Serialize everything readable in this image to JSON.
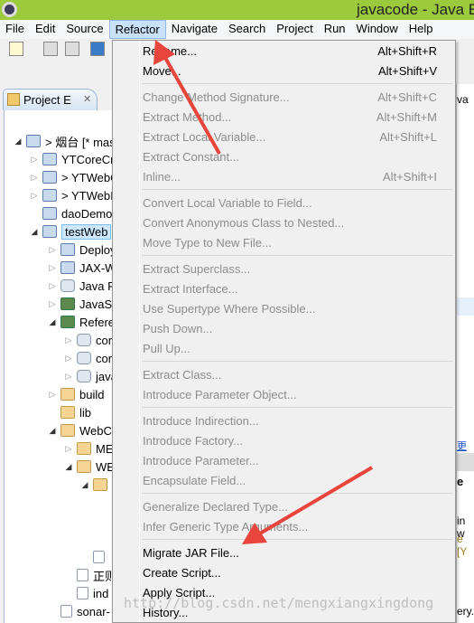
{
  "window": {
    "title": "javacode - Java EE"
  },
  "menubar": [
    "File",
    "Edit",
    "Source",
    "Refactor",
    "Navigate",
    "Search",
    "Project",
    "Run",
    "Window",
    "Help"
  ],
  "active_menu": "Refactor",
  "panel": {
    "tab_label": "Project E",
    "close": "✕"
  },
  "tree": [
    {
      "label": "> 烟台 [* mas",
      "depth": 0,
      "tw": "open",
      "icon": "proj"
    },
    {
      "label": "YTCoreCr",
      "depth": 1,
      "tw": "closed",
      "icon": "proj"
    },
    {
      "label": "> YTWebC",
      "depth": 1,
      "tw": "closed",
      "icon": "proj"
    },
    {
      "label": "> YTWebI",
      "depth": 1,
      "tw": "closed",
      "icon": "proj"
    },
    {
      "label": "daoDemo",
      "depth": 1,
      "tw": "",
      "icon": "proj"
    },
    {
      "label": "testWeb",
      "depth": 1,
      "tw": "open",
      "icon": "proj",
      "selected": true
    },
    {
      "label": "Deploy",
      "depth": 2,
      "tw": "closed",
      "icon": "proj"
    },
    {
      "label": "JAX-W",
      "depth": 2,
      "tw": "closed",
      "icon": "proj"
    },
    {
      "label": "Java R",
      "depth": 2,
      "tw": "closed",
      "icon": "jar"
    },
    {
      "label": "JavaSc",
      "depth": 2,
      "tw": "closed",
      "icon": "lib"
    },
    {
      "label": "Refere",
      "depth": 2,
      "tw": "open",
      "icon": "lib"
    },
    {
      "label": "cor",
      "depth": 3,
      "tw": "closed",
      "icon": "jar"
    },
    {
      "label": "cor",
      "depth": 3,
      "tw": "closed",
      "icon": "jar"
    },
    {
      "label": "java",
      "depth": 3,
      "tw": "closed",
      "icon": "jar"
    },
    {
      "label": "build",
      "depth": 2,
      "tw": "closed",
      "icon": "folder"
    },
    {
      "label": "lib",
      "depth": 2,
      "tw": "",
      "icon": "folder"
    },
    {
      "label": "WebCo",
      "depth": 2,
      "tw": "open",
      "icon": "folder"
    },
    {
      "label": "ME",
      "depth": 3,
      "tw": "closed",
      "icon": "folder"
    },
    {
      "label": "WE",
      "depth": 3,
      "tw": "open",
      "icon": "folder"
    },
    {
      "label": "",
      "depth": 4,
      "tw": "open",
      "icon": "folder"
    },
    {
      "label": "",
      "depth": 5,
      "tw": "",
      "icon": ""
    },
    {
      "label": "",
      "depth": 5,
      "tw": "",
      "icon": ""
    },
    {
      "label": "",
      "depth": 5,
      "tw": "",
      "icon": ""
    },
    {
      "label": "",
      "depth": 4,
      "tw": "",
      "icon": "file"
    },
    {
      "label": "正则",
      "depth": 3,
      "tw": "",
      "icon": "file"
    },
    {
      "label": "ind",
      "depth": 3,
      "tw": "",
      "icon": "file"
    },
    {
      "label": "sonar-",
      "depth": 2,
      "tw": "",
      "icon": "file"
    }
  ],
  "refactor_menu": [
    {
      "label": "Rename...",
      "shortcut": "Alt+Shift+R",
      "enabled": true
    },
    {
      "label": "Move...",
      "shortcut": "Alt+Shift+V",
      "enabled": true
    },
    {
      "sep": true
    },
    {
      "label": "Change Method Signature...",
      "shortcut": "Alt+Shift+C",
      "enabled": false
    },
    {
      "label": "Extract Method...",
      "shortcut": "Alt+Shift+M",
      "enabled": false
    },
    {
      "label": "Extract Local Variable...",
      "shortcut": "Alt+Shift+L",
      "enabled": false
    },
    {
      "label": "Extract Constant...",
      "shortcut": "",
      "enabled": false
    },
    {
      "label": "Inline...",
      "shortcut": "Alt+Shift+I",
      "enabled": false
    },
    {
      "sep": true
    },
    {
      "label": "Convert Local Variable to Field...",
      "shortcut": "",
      "enabled": false
    },
    {
      "label": "Convert Anonymous Class to Nested...",
      "shortcut": "",
      "enabled": false
    },
    {
      "label": "Move Type to New File...",
      "shortcut": "",
      "enabled": false
    },
    {
      "sep": true
    },
    {
      "label": "Extract Superclass...",
      "shortcut": "",
      "enabled": false
    },
    {
      "label": "Extract Interface...",
      "shortcut": "",
      "enabled": false
    },
    {
      "label": "Use Supertype Where Possible...",
      "shortcut": "",
      "enabled": false
    },
    {
      "label": "Push Down...",
      "shortcut": "",
      "enabled": false
    },
    {
      "label": "Pull Up...",
      "shortcut": "",
      "enabled": false
    },
    {
      "sep": true
    },
    {
      "label": "Extract Class...",
      "shortcut": "",
      "enabled": false
    },
    {
      "label": "Introduce Parameter Object...",
      "shortcut": "",
      "enabled": false
    },
    {
      "sep": true
    },
    {
      "label": "Introduce Indirection...",
      "shortcut": "",
      "enabled": false
    },
    {
      "label": "Introduce Factory...",
      "shortcut": "",
      "enabled": false
    },
    {
      "label": "Introduce Parameter...",
      "shortcut": "",
      "enabled": false
    },
    {
      "label": "Encapsulate Field...",
      "shortcut": "",
      "enabled": false
    },
    {
      "sep": true
    },
    {
      "label": "Generalize Declared Type...",
      "shortcut": "",
      "enabled": false
    },
    {
      "label": "Infer Generic Type Arguments...",
      "shortcut": "",
      "enabled": false
    },
    {
      "sep": true
    },
    {
      "label": "Migrate JAR File...",
      "shortcut": "",
      "enabled": true
    },
    {
      "label": "Create Script...",
      "shortcut": "",
      "enabled": true
    },
    {
      "label": "Apply Script...",
      "shortcut": "",
      "enabled": true
    },
    {
      "label": "History...",
      "shortcut": "",
      "enabled": true
    }
  ],
  "right_fragments": {
    "tab": "va",
    "link": "更送",
    "tab2": "e",
    "line1": "in w",
    "line2": "e [Y",
    "line3": "ery.a"
  },
  "watermark": "http://blog.csdn.net/mengxiangxingdong",
  "colors": {
    "titlebar": "#9bcb3c",
    "annotation_arrow": "#e8463c",
    "menu_active": "#c8e0f8"
  }
}
